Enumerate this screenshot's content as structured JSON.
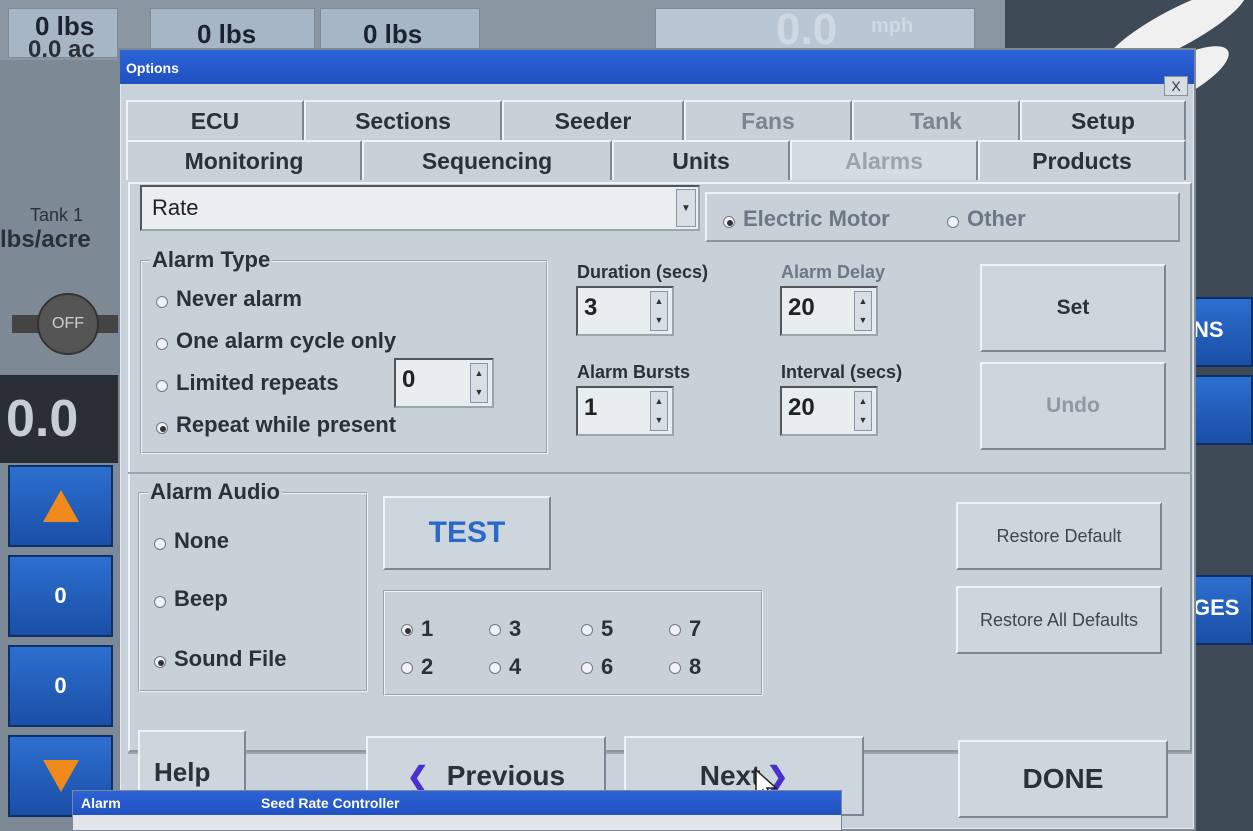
{
  "background": {
    "cells": [
      "0 lbs",
      "0 lbs",
      "0 lbs"
    ],
    "acres": "0.0 ac",
    "speed_value": "0.0",
    "speed_unit": "mph",
    "tank_label": "Tank 1",
    "rate_label": "lbs/acre",
    "off_label": "OFF",
    "big_zero": "0.0",
    "left_buttons": [
      "0",
      "0"
    ],
    "right_labels": [
      "NS",
      "GES"
    ]
  },
  "dialog": {
    "title": "Options",
    "close_label": "X",
    "tabs_row1": [
      "ECU",
      "Sections",
      "Seeder",
      "Fans",
      "Tank",
      "Setup"
    ],
    "tabs_row2": [
      "Monitoring",
      "Sequencing",
      "Units",
      "Alarms",
      "Products"
    ],
    "active_tab": "Alarms",
    "combo_value": "Rate",
    "motor_options": [
      "Electric Motor",
      "Other"
    ],
    "alarm_type": {
      "title": "Alarm Type",
      "options": [
        "Never alarm",
        "One alarm cycle only",
        "Limited repeats",
        "Repeat while present"
      ],
      "selected": "Repeat while present",
      "limited_repeats_value": "0"
    },
    "duration": {
      "label": "Duration (secs)",
      "value": "3"
    },
    "alarm_delay": {
      "label": "Alarm Delay",
      "value": "20"
    },
    "alarm_bursts": {
      "label": "Alarm Bursts",
      "value": "1"
    },
    "interval": {
      "label": "Interval (secs)",
      "value": "20"
    },
    "set_label": "Set",
    "undo_label": "Undo",
    "alarm_audio": {
      "title": "Alarm Audio",
      "options": [
        "None",
        "Beep",
        "Sound File"
      ],
      "selected": "Sound File"
    },
    "test_label": "TEST",
    "sound_numbers": [
      "1",
      "3",
      "5",
      "7",
      "2",
      "4",
      "6",
      "8"
    ],
    "sound_selected": "1",
    "restore_default_label": "Restore Default",
    "restore_all_label": "Restore All Defaults",
    "help_label": "Help",
    "previous_label": "Previous",
    "next_label": "Next",
    "done_label": "DONE"
  },
  "alarm_bar": {
    "left": "Alarm",
    "title": "Seed Rate Controller"
  }
}
